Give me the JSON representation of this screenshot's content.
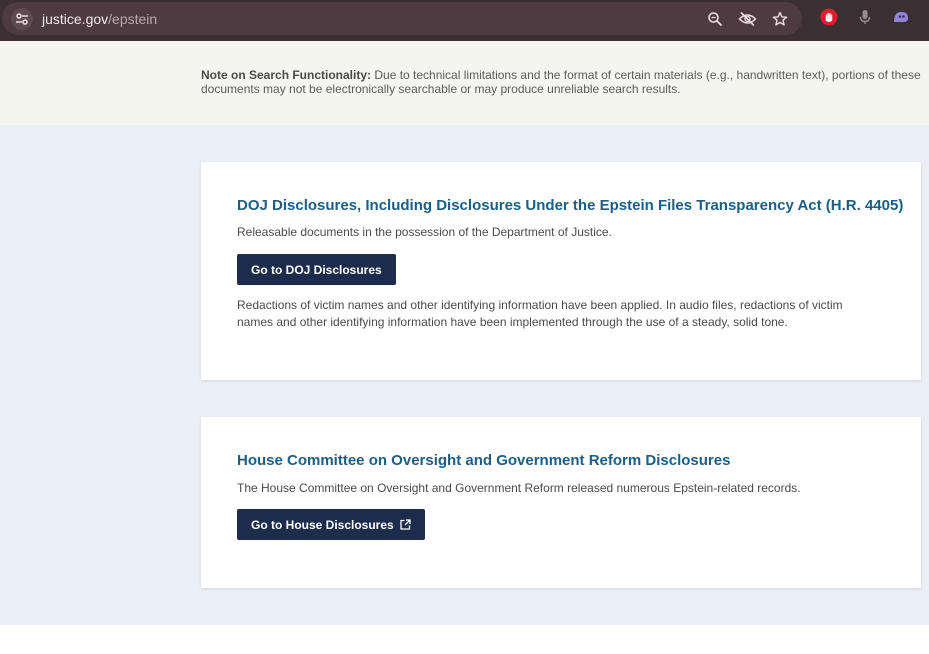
{
  "browser": {
    "url_domain": "justice.gov",
    "url_path": "/epstein"
  },
  "note": {
    "label": "Note on Search Functionality:",
    "text": " Due to technical limitations and the format of certain materials (e.g., handwritten text), portions of these documents may not be electronically searchable or may produce unreliable search results."
  },
  "sections": [
    {
      "title": "DOJ Disclosures, Including Disclosures Under the Epstein Files Transparency Act (H.R. 4405)",
      "description": "Releasable documents in the possession of the Department of Justice.",
      "button_label": "Go to DOJ Disclosures",
      "note": "Redactions of victim names and other identifying information have been applied. In audio files, redactions of victim names and other identifying information have been implemented through the use of a steady, solid tone."
    },
    {
      "title": "House Committee on Oversight and Government Reform Disclosures",
      "description": "The House Committee on Oversight and Government Reform released numerous Epstein-related records.",
      "button_label": "Go to House Disclosures"
    }
  ],
  "colors": {
    "toolbar": "#3c2f33",
    "note_band": "#f5f5f0",
    "body_background": "#eaeef5",
    "title": "#1b5e86",
    "button": "#1c2c4c"
  },
  "icons": {
    "site_info": "tune-icon",
    "zoom": "zoom-icon",
    "visibility_off": "eye-off-icon",
    "bookmark": "star-icon",
    "extension_1": "red-hand-extension-icon",
    "mic": "microphone-icon",
    "extension_2": "purple-extension-icon",
    "external_link": "external-link-icon"
  }
}
